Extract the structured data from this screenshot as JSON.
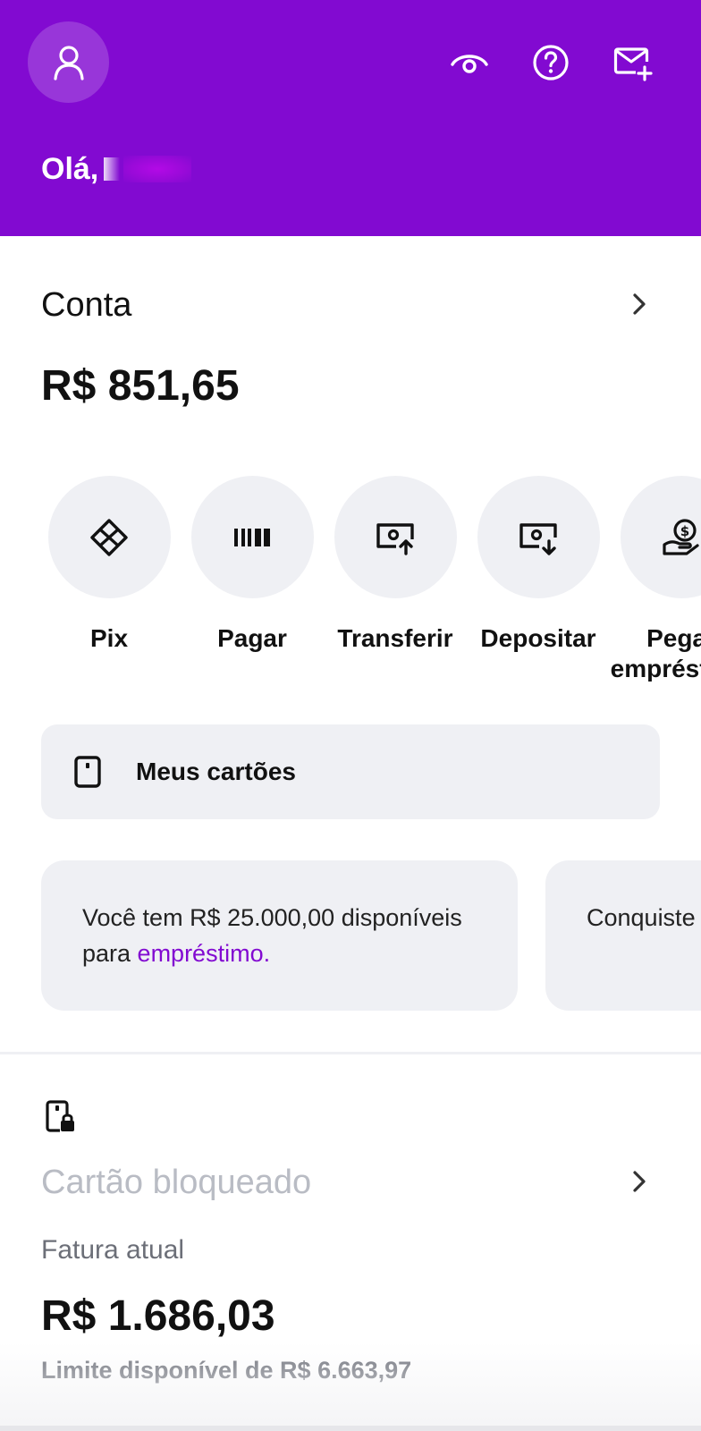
{
  "header": {
    "greeting": "Olá,",
    "icons": [
      "user-icon",
      "eye-icon",
      "help-icon",
      "mail-plus-icon"
    ],
    "background": "#820ad1"
  },
  "account": {
    "title": "Conta",
    "balance": "R$ 851,65"
  },
  "actions": [
    {
      "label": "Pix",
      "icon": "pix-icon"
    },
    {
      "label": "Pagar",
      "icon": "barcode-icon"
    },
    {
      "label": "Transferir",
      "icon": "transfer-out-icon"
    },
    {
      "label": "Depositar",
      "icon": "deposit-in-icon"
    },
    {
      "label": "Pegar empréstimo",
      "icon": "loan-icon"
    }
  ],
  "my_cards": {
    "label": "Meus cartões",
    "icon": "card-icon"
  },
  "promos": [
    {
      "text_before": "Você tem R$ 25.000,00 disponíveis para ",
      "highlight": "empréstimo."
    },
    {
      "text": "Conquiste e conheça a"
    }
  ],
  "credit_card": {
    "status": "Cartão bloqueado",
    "invoice_label": "Fatura atual",
    "invoice_value": "R$ 1.686,03",
    "limit_text": "Limite disponível de R$ 6.663,97",
    "icon": "card-lock-icon"
  },
  "colors": {
    "brand": "#820ad1",
    "surface": "#eff0f4",
    "muted": "#6c6f78",
    "disabled": "#b9bcc4"
  }
}
